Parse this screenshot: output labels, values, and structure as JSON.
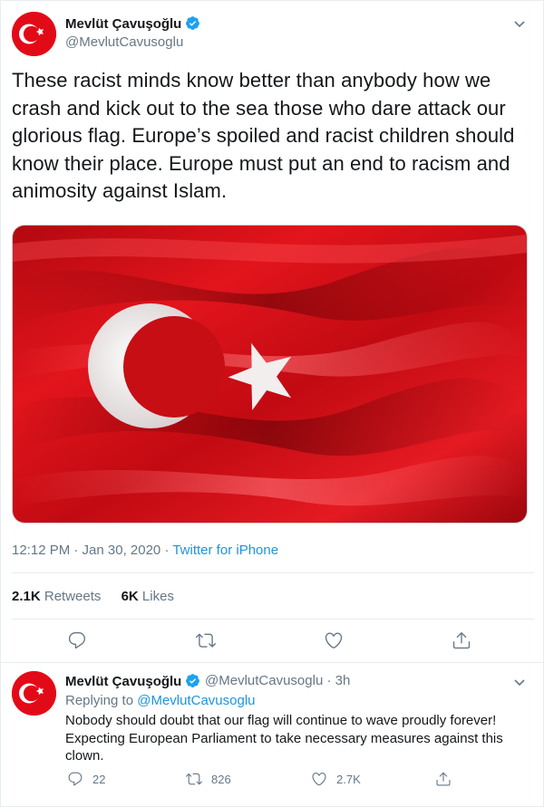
{
  "tweet": {
    "author_name": "Mevlüt Çavuşoğlu",
    "author_handle": "@MevlutCavusoglu",
    "text": "These racist minds know better than anybody how we crash and kick out to the sea those who dare attack our glorious flag. Europe’s spoiled and racist children should know their place. Europe must put an end to racism and animosity against Islam.",
    "time": "12:12 PM · Jan 30, 2020",
    "separator": " · ",
    "source": "Twitter for iPhone",
    "retweets_count": "2.1K",
    "retweets_label": "Retweets",
    "likes_count": "6K",
    "likes_label": "Likes"
  },
  "reply": {
    "author_name": "Mevlüt Çavuşoğlu",
    "author_handle": "@MevlutCavusoglu",
    "age": " · 3h",
    "replying_prefix": "Replying to ",
    "replying_to": "@MevlutCavusoglu",
    "text": "Nobody should doubt that our flag will continue to wave proudly forever! Expecting European Parliament to take necessary measures against this clown.",
    "reply_count": "22",
    "retweet_count": "826",
    "like_count": "2.7K"
  },
  "colors": {
    "link": "#1b95e0",
    "secondary_text": "#657786",
    "flag_red": "#e30a17",
    "verified_blue": "#1da1f2"
  },
  "icons": [
    "chevron-down-icon",
    "verified-badge-icon",
    "reply-icon",
    "retweet-icon",
    "like-icon",
    "share-icon"
  ]
}
